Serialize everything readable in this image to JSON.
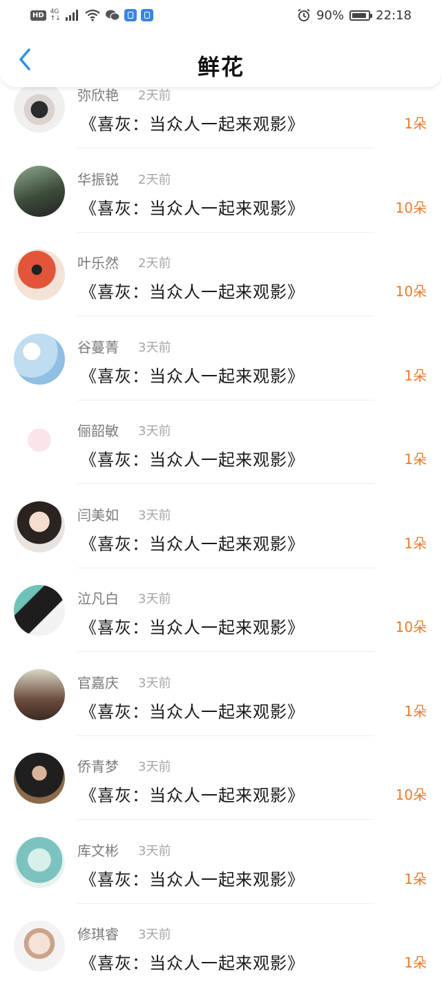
{
  "status_bar": {
    "hd": "HD",
    "network": "4G",
    "network_sub": "↑↓",
    "battery_percent": "90%",
    "battery_level": 0.9,
    "time": "22:18",
    "icons": [
      "signal-icon",
      "wifi-icon",
      "wechat-icon",
      "app-badge-icon",
      "alarm-icon",
      "battery-icon"
    ]
  },
  "header": {
    "title": "鲜花",
    "back_icon": "chevron-left-icon",
    "accent_color": "#2e8de8"
  },
  "colors": {
    "flower_count": "#ef7a2d",
    "name": "#7a7a7a",
    "time": "#a6a6a6"
  },
  "items": [
    {
      "name": "弥欣艳",
      "time": "2天前",
      "title": "《喜灰：当众人一起来观影》",
      "count": "1朵"
    },
    {
      "name": "华振锐",
      "time": "2天前",
      "title": "《喜灰：当众人一起来观影》",
      "count": "10朵"
    },
    {
      "name": "叶乐然",
      "time": "2天前",
      "title": "《喜灰：当众人一起来观影》",
      "count": "10朵"
    },
    {
      "name": "谷蔓菁",
      "time": "3天前",
      "title": "《喜灰：当众人一起来观影》",
      "count": "1朵"
    },
    {
      "name": "俪韶敏",
      "time": "3天前",
      "title": "《喜灰：当众人一起来观影》",
      "count": "1朵"
    },
    {
      "name": "闫美如",
      "time": "3天前",
      "title": "《喜灰：当众人一起来观影》",
      "count": "1朵"
    },
    {
      "name": "泣凡白",
      "time": "3天前",
      "title": "《喜灰：当众人一起来观影》",
      "count": "10朵"
    },
    {
      "name": "官嘉庆",
      "time": "3天前",
      "title": "《喜灰：当众人一起来观影》",
      "count": "1朵"
    },
    {
      "name": "侨青梦",
      "time": "3天前",
      "title": "《喜灰：当众人一起来观影》",
      "count": "10朵"
    },
    {
      "name": "库文彬",
      "time": "3天前",
      "title": "《喜灰：当众人一起来观影》",
      "count": "1朵"
    },
    {
      "name": "修琪睿",
      "time": "3天前",
      "title": "《喜灰：当众人一起来观影》",
      "count": "1朵"
    }
  ]
}
